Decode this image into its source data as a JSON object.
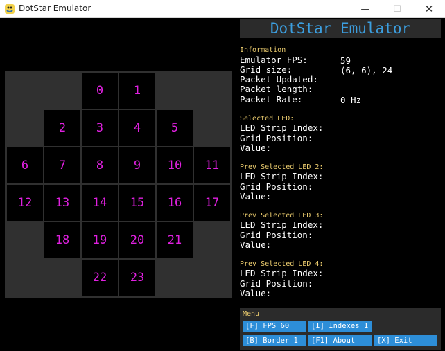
{
  "window": {
    "title": "DotStar Emulator"
  },
  "header": {
    "title": "DotStar Emulator"
  },
  "info": {
    "section_title": "Information",
    "fps_label": "Emulator FPS:",
    "fps_value": "59",
    "grid_label": "Grid size:",
    "grid_value": "(6, 6), 24",
    "packet_updated_label": "Packet Updated:",
    "packet_length_label": "Packet length:",
    "packet_rate_label": "Packet Rate:",
    "packet_rate_value": "0 Hz"
  },
  "selected": [
    {
      "title": "Selected LED:",
      "index_label": "LED Strip Index:",
      "pos_label": "Grid Position:",
      "value_label": "Value:"
    },
    {
      "title": "Prev Selected LED 2:",
      "index_label": "LED Strip Index:",
      "pos_label": "Grid Position:",
      "value_label": "Value:"
    },
    {
      "title": "Prev Selected LED 3:",
      "index_label": "LED Strip Index:",
      "pos_label": "Grid Position:",
      "value_label": "Value:"
    },
    {
      "title": "Prev Selected LED 4:",
      "index_label": "LED Strip Index:",
      "pos_label": "Grid Position:",
      "value_label": "Value:"
    }
  ],
  "menu": {
    "title": "Menu",
    "fps": "[F] FPS 60",
    "indexes": "[I] Indexes 1",
    "border": "[B] Border 1",
    "about": "[F1] About",
    "exit": "[X] Exit"
  },
  "leds": [
    "0",
    "1",
    "2",
    "3",
    "4",
    "5",
    "6",
    "7",
    "8",
    "9",
    "10",
    "11",
    "12",
    "13",
    "14",
    "15",
    "16",
    "17",
    "18",
    "19",
    "20",
    "21",
    "22",
    "23"
  ],
  "colors": {
    "led_label": "#e020e0",
    "accent": "#3c9fe0",
    "section": "#f0d070",
    "button": "#2d8ed8"
  }
}
